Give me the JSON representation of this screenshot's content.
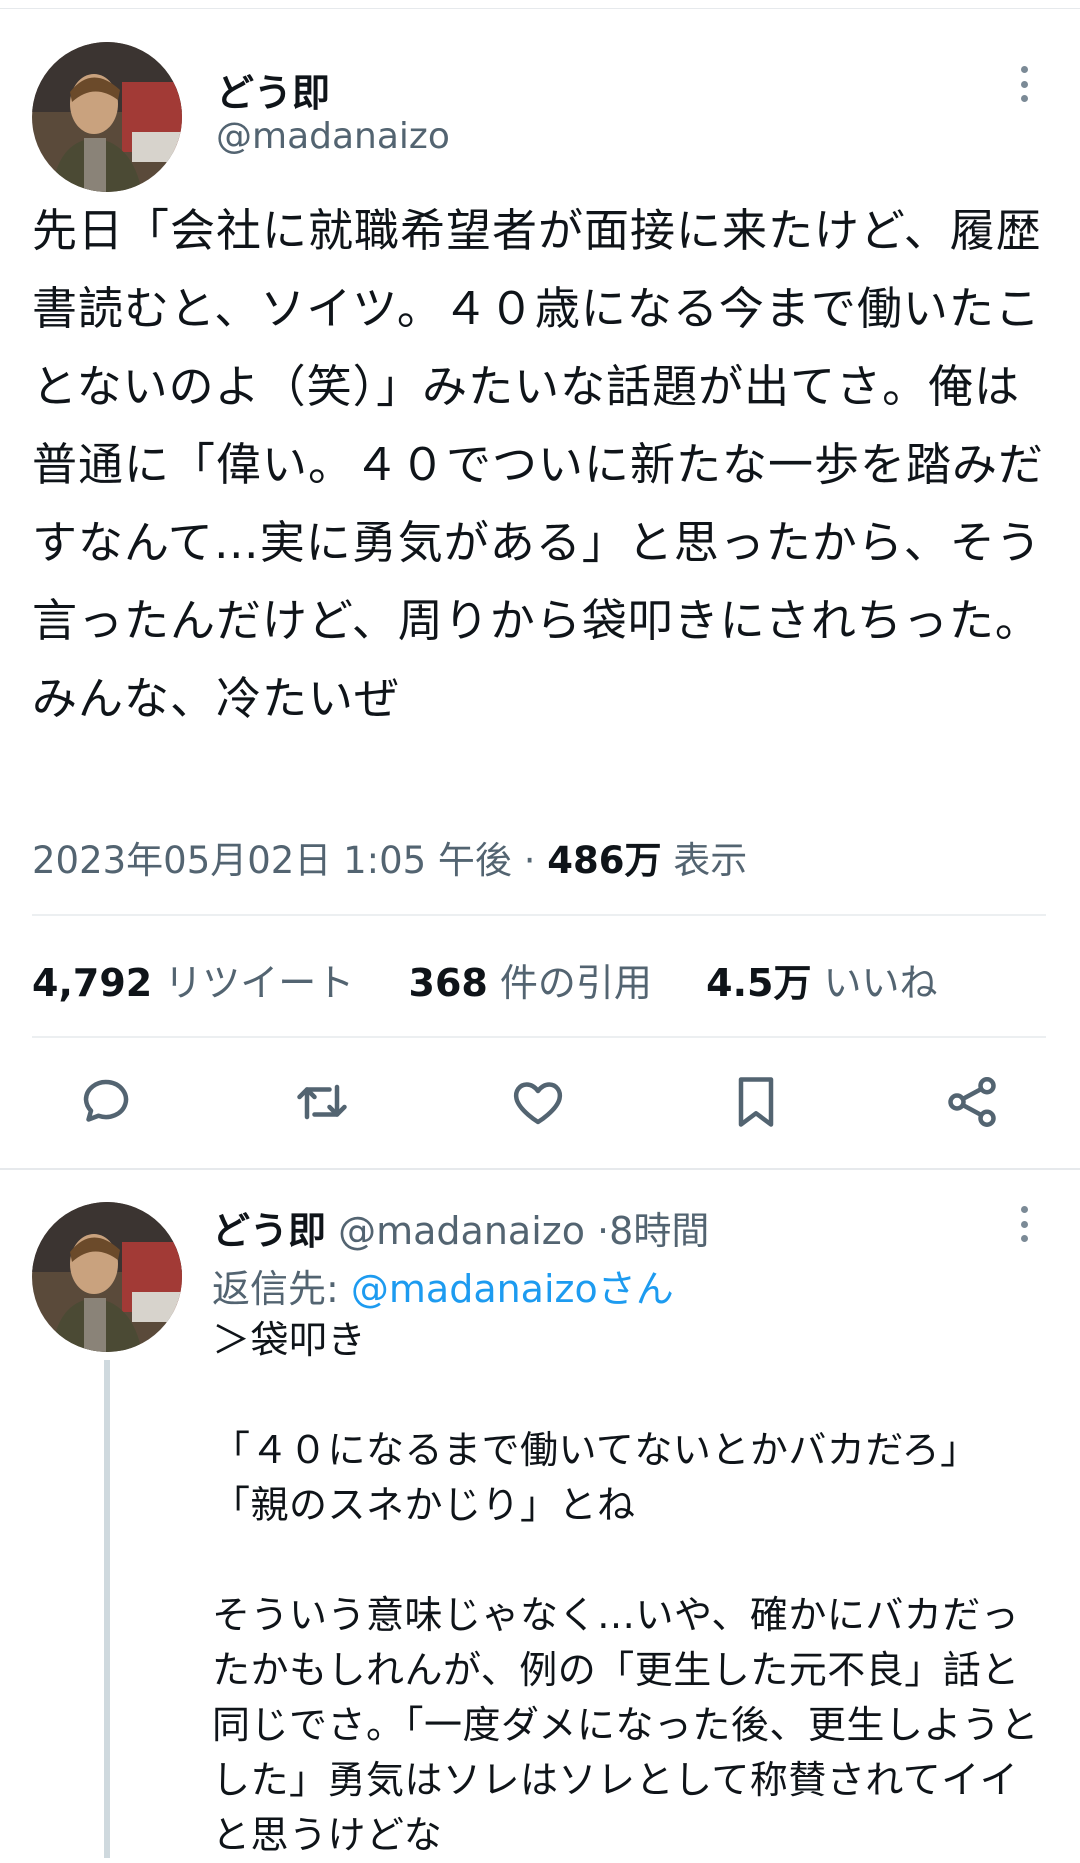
{
  "main_tweet": {
    "display_name": "どう即",
    "handle": "@madanaizo",
    "text": "先日「会社に就職希望者が面接に来たけど、履歴書読むと、ソイツ。４０歳になる今まで働いたことないのよ（笑）」みたいな話題が出てさ。俺は普通に「偉い。４０でついに新たな一歩を踏みだすなんて…実に勇気がある」と思ったから、そう言ったんだけど、周りから袋叩きにされちった。みんな、冷たいぜ",
    "timestamp": "2023年05月02日 1:05 午後",
    "separator": "·",
    "views_count": "486万",
    "views_label": "表示",
    "stats": {
      "retweets_count": "4,792",
      "retweets_label": "リツイート",
      "quotes_count": "368",
      "quotes_label": "件の引用",
      "likes_count": "4.5万",
      "likes_label": "いいね"
    },
    "actions": [
      "reply-icon",
      "retweet-icon",
      "like-icon",
      "bookmark-icon",
      "share-icon"
    ]
  },
  "reply_tweet": {
    "display_name": "どう即",
    "handle": "@madanaizo",
    "separator": "·",
    "time_ago": "8時間",
    "reply_to_label": "返信先: ",
    "reply_to_handle": "@madanaizoさん",
    "text": "＞袋叩き\n\n「４０になるまで働いてないとかバカだろ」\n「親のスネかじり」とね\n\nそういう意味じゃなく…いや、確かにバカだったかもしれんが、例の「更生した元不良」話と同じでさ。「一度ダメになった後、更生しようとした」勇気はソレはソレとして称賛されてイイと思うけどな"
  },
  "colors": {
    "text": "#0f1419",
    "secondary": "#536471",
    "link": "#1d9bf0",
    "divider": "#eceff1",
    "thread_line": "#cfd9de"
  }
}
